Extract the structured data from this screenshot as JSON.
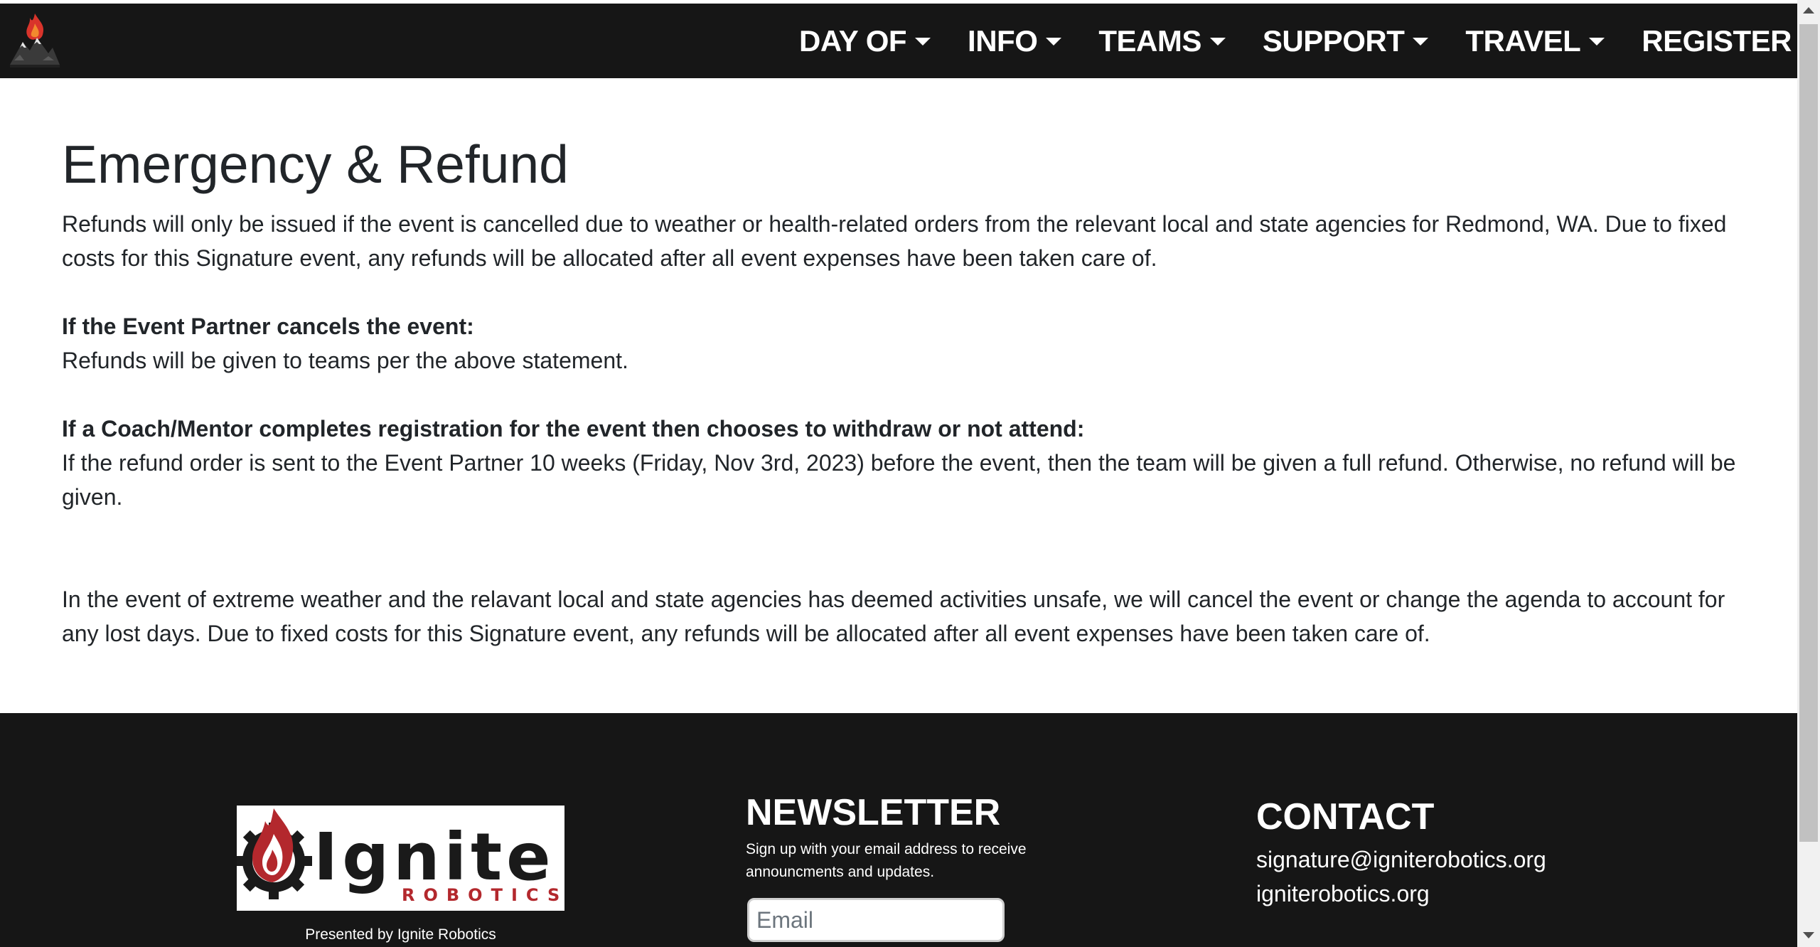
{
  "nav": {
    "items": [
      {
        "label": "DAY OF",
        "dropdown": true
      },
      {
        "label": "INFO",
        "dropdown": true
      },
      {
        "label": "TEAMS",
        "dropdown": true
      },
      {
        "label": "SUPPORT",
        "dropdown": true
      },
      {
        "label": "TRAVEL",
        "dropdown": true
      },
      {
        "label": "REGISTER",
        "dropdown": false
      }
    ]
  },
  "main": {
    "title": "Emergency & Refund",
    "intro": "Refunds will only be issued if the event is cancelled due to weather or health-related orders from the relevant local and state agencies for Redmond, WA. Due to fixed costs for this Signature event, any refunds will be allocated after all event expenses have been taken care of.",
    "partner_heading": "If the Event Partner cancels the event:",
    "partner_text": "Refunds will be given to teams per the above statement.",
    "coach_heading": "If a Coach/Mentor completes registration for the event then chooses to withdraw or not attend:",
    "coach_text": "If the refund order is sent to the Event Partner 10 weeks (Friday, Nov 3rd, 2023) before the event, then the team will be given a full refund. Otherwise, no refund will be given.",
    "weather_text": "In the event of extreme weather and the relavant local and state agencies has deemed activities unsafe, we will cancel the event or change the agenda to account for any lost days. Due to fixed costs for this Signature event, any refunds will be allocated after all event expenses have been taken care of."
  },
  "footer": {
    "logo_word": "Ignite",
    "logo_sub": "ROBOTICS",
    "presented_by": "Presented by Ignite Robotics",
    "newsletter": {
      "heading": "NEWSLETTER",
      "description": "Sign up with your email address to receive announcments and updates.",
      "email_placeholder": "Email"
    },
    "contact": {
      "heading": "CONTACT",
      "email": "signature@igniterobotics.org",
      "website": "igniterobotics.org"
    }
  },
  "colors": {
    "navbar_bg": "#161616",
    "footer_bg": "#161616",
    "logo_red": "#b3282d",
    "text": "#212529"
  },
  "icons": {
    "brand": "flame-mountain-logo",
    "caret": "caret-down-icon"
  }
}
